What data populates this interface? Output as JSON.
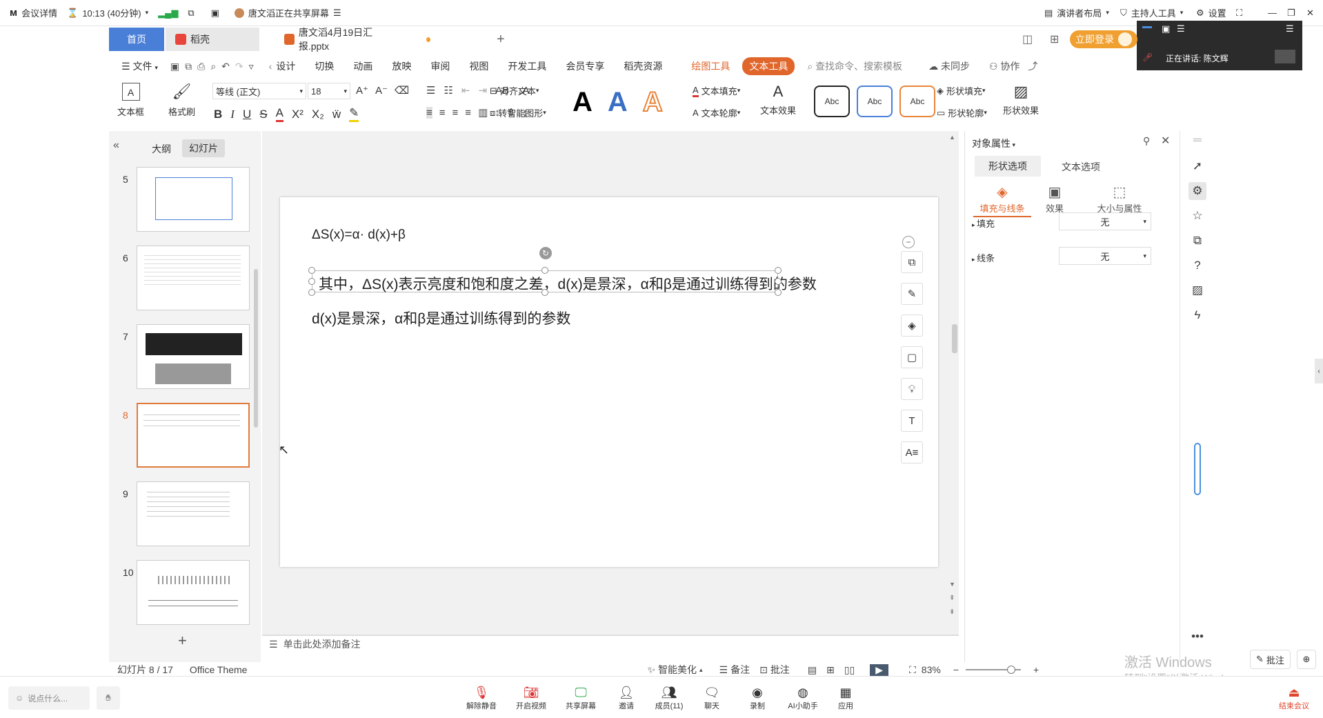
{
  "meeting": {
    "details": "会议详情",
    "timer": "10:13 (40分钟)",
    "sharing_status": "唐文滔正在共享屏幕",
    "presenter_layout": "演讲者布局",
    "host_tools": "主持人工具",
    "settings": "设置",
    "speaking_label": "正在讲话:",
    "speaking_name": "陈文辉"
  },
  "wps_tabs": {
    "home": "首页",
    "app": "稻壳",
    "doc": "唐文滔4月19日汇报.pptx",
    "login": "立即登录"
  },
  "menu": {
    "file": "文件",
    "items": [
      "设计",
      "切换",
      "动画",
      "放映",
      "审阅",
      "视图",
      "开发工具",
      "会员专享",
      "稻壳资源"
    ],
    "draw_tools": "绘图工具",
    "text_tools": "文本工具",
    "search_placeholder": "查找命令、搜索模板",
    "sync": "未同步",
    "collab": "协作"
  },
  "toolbar": {
    "textbox": "文本框",
    "format_painter": "格式刷",
    "font_name": "等线 (正文)",
    "font_size": "18",
    "align_text": "对齐文本",
    "smart_shape": "转智能图形",
    "text_fill": "文本填充",
    "text_outline": "文本轮廓",
    "text_effect": "文本效果",
    "style_sample": "Abc",
    "shape_fill": "形状填充",
    "shape_outline": "形状轮廓",
    "shape_effect": "形状效果"
  },
  "left_panel": {
    "tab_outline": "大纲",
    "tab_slides": "幻灯片",
    "slide_numbers": [
      "5",
      "6",
      "7",
      "8",
      "9",
      "10"
    ]
  },
  "slide": {
    "formula": "ΔS(x)=α· d(x)+β",
    "selected_text": "其中，ΔS(x)表示亮度和饱和度之差，d(x)是景深，α和β是通过训练得到的参数",
    "line2": "d(x)是景深，α和β是通过训练得到的参数"
  },
  "notes_placeholder": "单击此处添加备注",
  "properties": {
    "title": "对象属性",
    "tab_shape": "形状选项",
    "tab_text": "文本选项",
    "sub_fill_line": "填充与线条",
    "sub_effect": "效果",
    "sub_size": "大小与属性",
    "fill_label": "填充",
    "fill_value": "无",
    "line_label": "线条",
    "line_value": "无"
  },
  "status": {
    "slide_count": "幻灯片 8 / 17",
    "theme": "Office Theme",
    "smart_beautify": "智能美化",
    "notes": "备注",
    "comments": "批注",
    "zoom": "83%"
  },
  "watermark": {
    "line1": "激活 Windows",
    "line2": "转到\"设置\"以激活 Windows。"
  },
  "bottom": {
    "chat_placeholder": "说点什么...",
    "unmute": "解除静音",
    "video": "开启视频",
    "share": "共享屏幕",
    "invite": "邀请",
    "members": "成员(11)",
    "chat": "聊天",
    "record": "录制",
    "ai": "AI小助手",
    "apps": "应用",
    "annotate": "批注",
    "end": "结束会议"
  },
  "colors": {
    "accent": "#e0662b",
    "tab_blue": "#4a7fd8",
    "dark_panel": "#2b2b2b"
  }
}
